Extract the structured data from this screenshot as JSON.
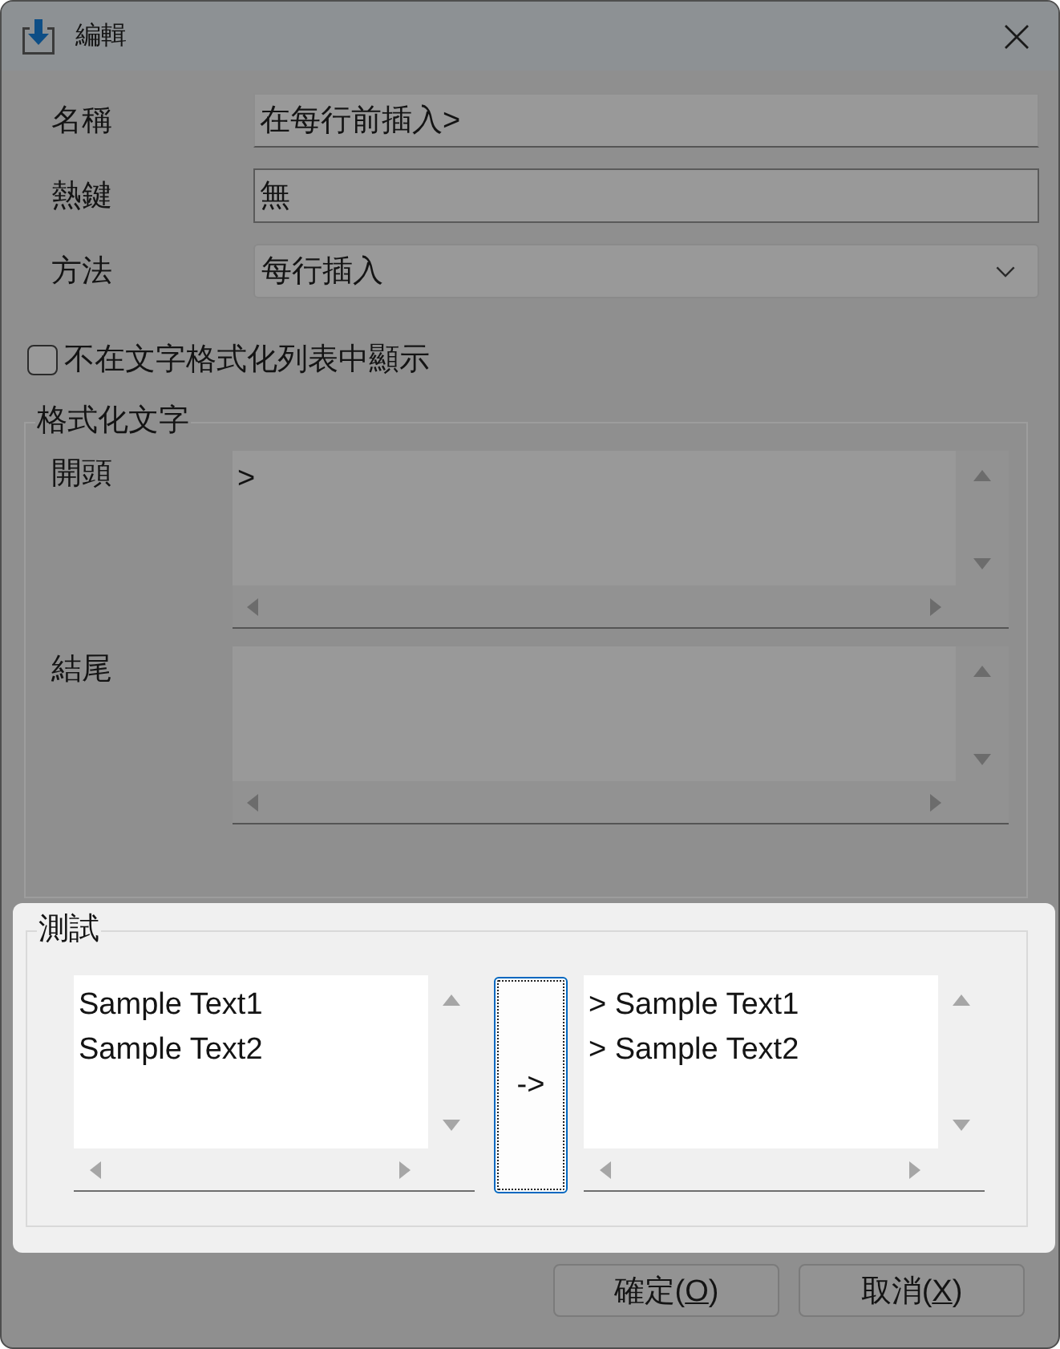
{
  "window": {
    "title": "編輯"
  },
  "fields": [
    {
      "kind": "text",
      "label": "名稱",
      "value": "在每行前插入>"
    },
    {
      "kind": "hotkey",
      "label": "熱鍵",
      "value": "無"
    },
    {
      "kind": "dropdown",
      "label": "方法",
      "value": "每行插入"
    }
  ],
  "hide_option": {
    "label": "不在文字格式化列表中顯示",
    "checked": false
  },
  "format_group": {
    "title": "格式化文字",
    "highlighted": false,
    "areas": [
      {
        "label": "開頭",
        "lines": [
          ">"
        ]
      },
      {
        "label": "結尾"
      }
    ]
  },
  "test_group": {
    "title": "測試",
    "highlighted": true,
    "input_lines": [
      "Sample Text1",
      "Sample Text2"
    ],
    "convert_button": {
      "label": "->",
      "focused": true
    },
    "output_lines": [
      "> Sample Text1",
      "> Sample Text2"
    ]
  },
  "buttons": [
    {
      "before": "確定(",
      "access_key": "O",
      "after": ")"
    },
    {
      "before": "取消(",
      "access_key": "X",
      "after": ")"
    }
  ]
}
